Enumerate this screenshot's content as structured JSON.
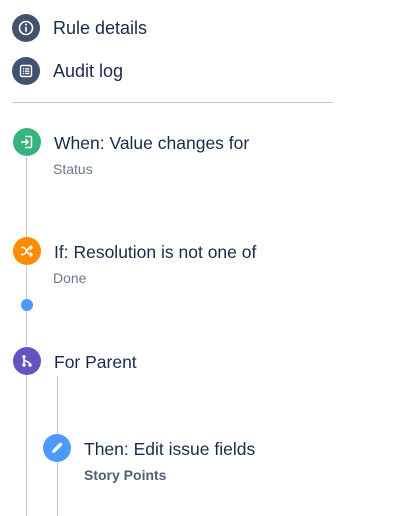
{
  "nav": {
    "rule_details_label": "Rule details",
    "audit_log_label": "Audit log"
  },
  "rule": {
    "trigger": {
      "title": "When: Value changes for",
      "subtitle": "Status"
    },
    "condition": {
      "title": "If: Resolution is not one of",
      "subtitle": "Done"
    },
    "branch": {
      "title": "For Parent"
    },
    "action": {
      "title": "Then: Edit issue fields",
      "subtitle": "Story Points"
    }
  },
  "colors": {
    "nav_icon": "#42526e",
    "trigger": "#36b37e",
    "condition": "#ff8b00",
    "branch": "#6554c0",
    "action": "#4c9aff",
    "add_dot": "#4c9aff"
  },
  "icons": {
    "rule_details": "info-icon",
    "audit_log": "list-icon",
    "trigger": "trigger-enter-icon",
    "condition": "shuffle-icon",
    "branch": "branch-icon",
    "action": "pencil-icon"
  }
}
